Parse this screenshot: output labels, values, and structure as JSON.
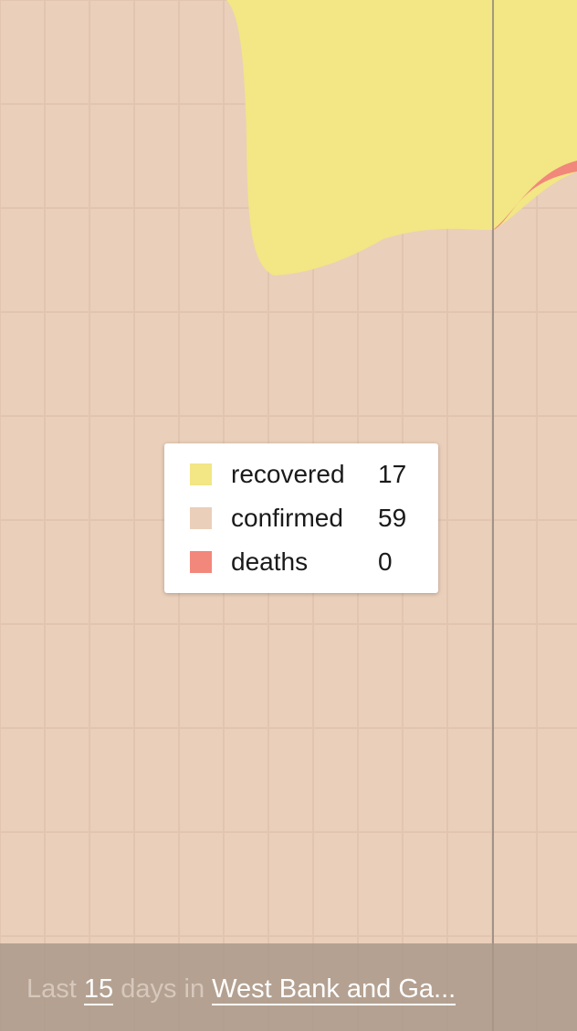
{
  "chart_data": {
    "type": "area",
    "series": [
      {
        "name": "recovered",
        "color": "#f2e685"
      },
      {
        "name": "confirmed",
        "color": "#eacfba"
      },
      {
        "name": "deaths",
        "color": "#f2877b"
      }
    ]
  },
  "tooltip": {
    "rows": [
      {
        "label": "recovered",
        "value": "17",
        "color": "#f2e685"
      },
      {
        "label": "confirmed",
        "value": "59",
        "color": "#eacfba"
      },
      {
        "label": "deaths",
        "value": "0",
        "color": "#f2877b"
      }
    ]
  },
  "footer": {
    "prefix": "Last",
    "days": "15",
    "middle": "days in",
    "region": "West Bank and Ga..."
  },
  "colors": {
    "background": "#eacfba",
    "grid": "#e2c5b0",
    "cursor_line": "#8a8078",
    "footer_bg": "#a8968780"
  }
}
